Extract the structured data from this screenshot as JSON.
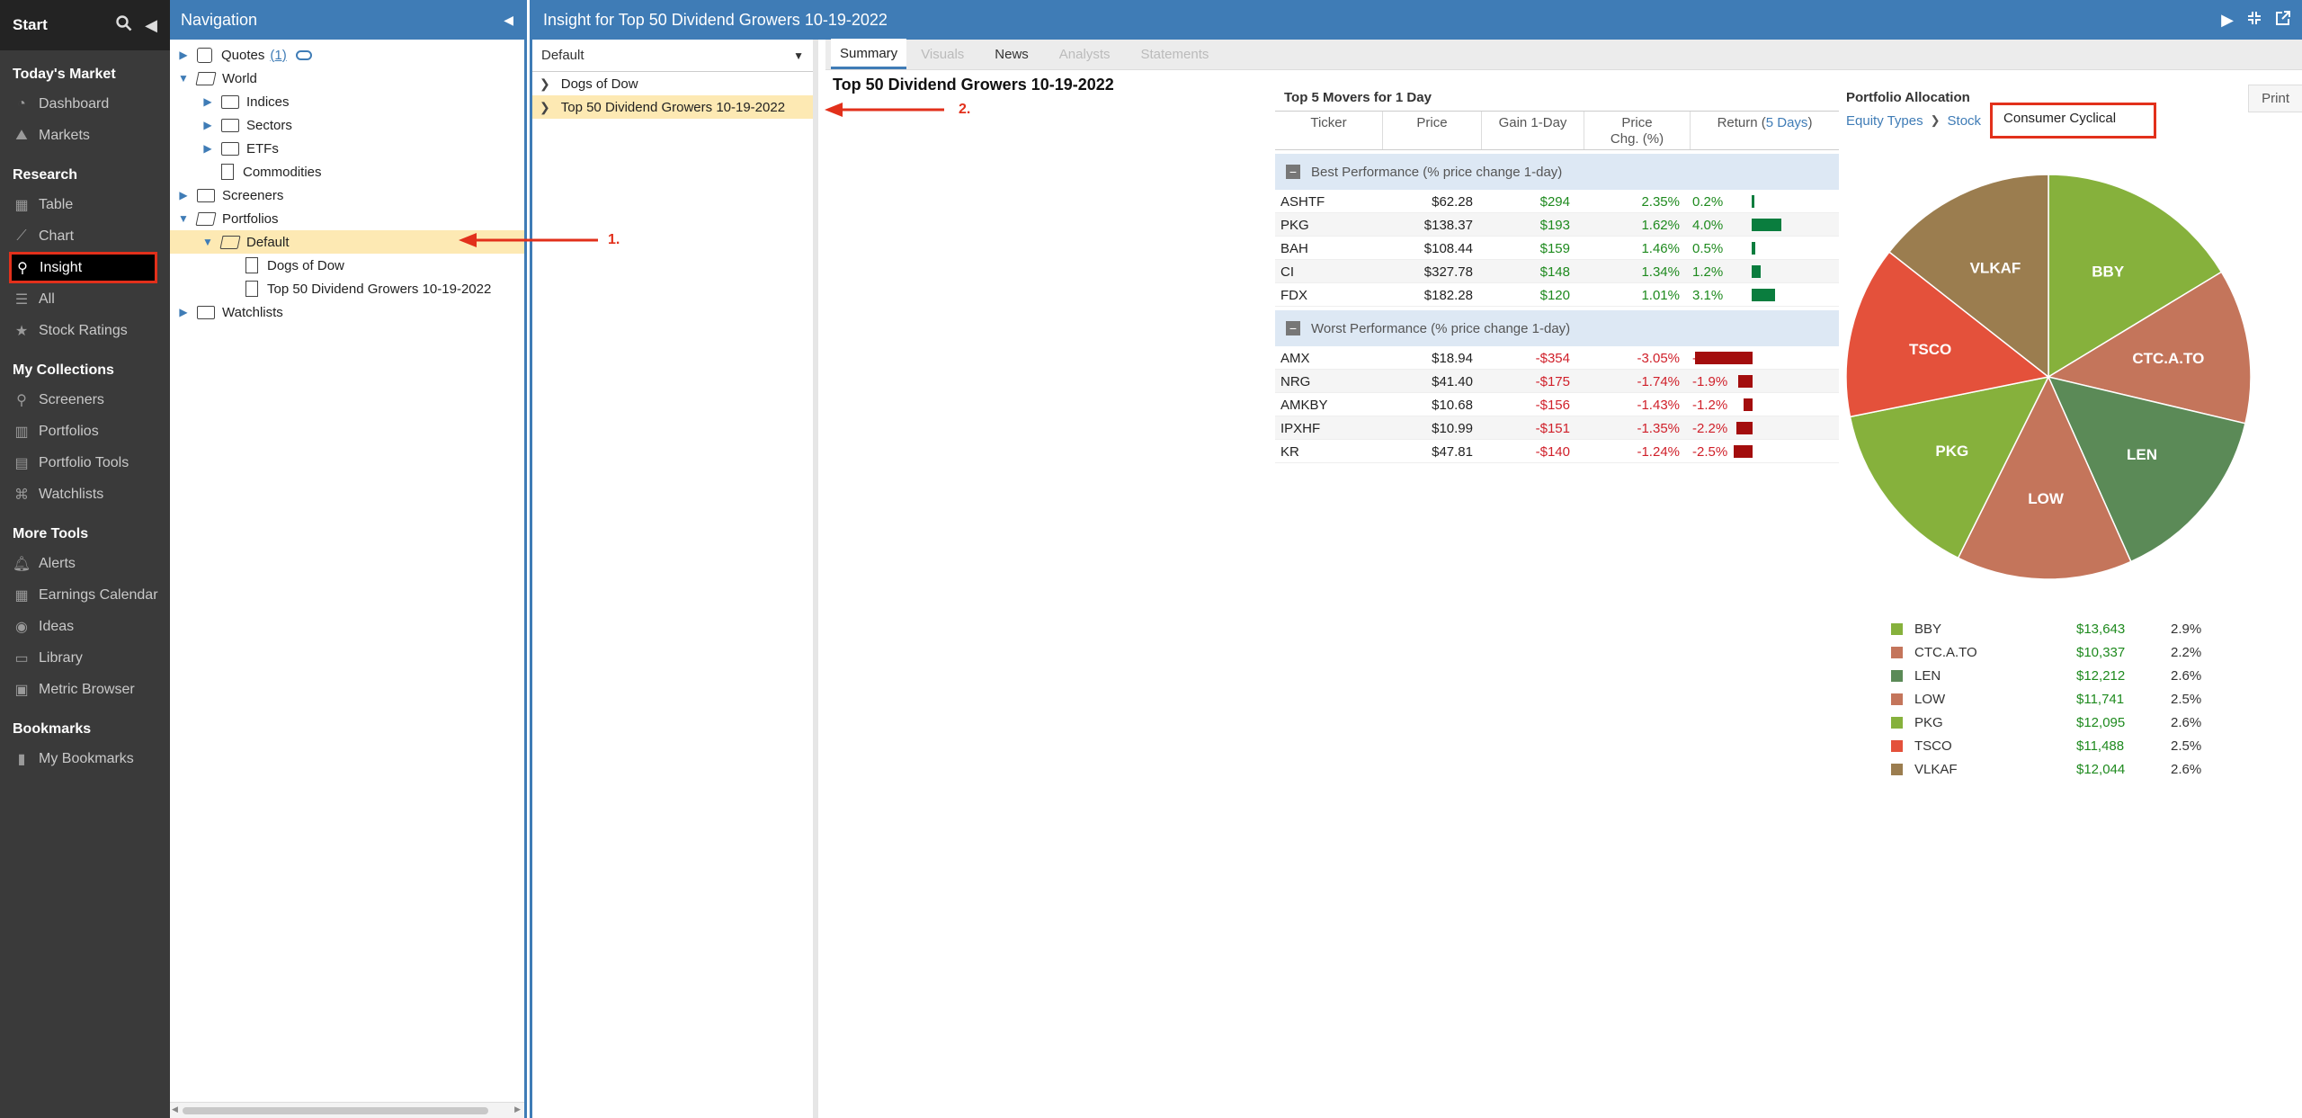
{
  "app": {
    "start_label": "Start"
  },
  "sidebar": {
    "sections": [
      {
        "title": "Today's Market",
        "items": [
          {
            "label": "Dashboard",
            "icon": "dashboard-icon"
          },
          {
            "label": "Markets",
            "icon": "area-chart-icon"
          }
        ]
      },
      {
        "title": "Research",
        "items": [
          {
            "label": "Table",
            "icon": "table-icon"
          },
          {
            "label": "Chart",
            "icon": "line-chart-icon"
          },
          {
            "label": "Insight",
            "icon": "microscope-icon",
            "active": true
          },
          {
            "label": "All",
            "icon": "list-icon"
          },
          {
            "label": "Stock Ratings",
            "icon": "star-icon"
          }
        ]
      },
      {
        "title": "My Collections",
        "items": [
          {
            "label": "Screeners",
            "icon": "search-icon"
          },
          {
            "label": "Portfolios",
            "icon": "briefcase-icon"
          },
          {
            "label": "Portfolio Tools",
            "icon": "chart-icon"
          },
          {
            "label": "Watchlists",
            "icon": "binoculars-icon"
          }
        ]
      },
      {
        "title": "More Tools",
        "items": [
          {
            "label": "Alerts",
            "icon": "bell-icon"
          },
          {
            "label": "Earnings Calendar",
            "icon": "calendar-icon"
          },
          {
            "label": "Ideas",
            "icon": "lightbulb-icon"
          },
          {
            "label": "Library",
            "icon": "book-icon"
          },
          {
            "label": "Metric Browser",
            "icon": "browser-icon"
          }
        ]
      },
      {
        "title": "Bookmarks",
        "items": [
          {
            "label": "My Bookmarks",
            "icon": "bookmark-icon"
          }
        ]
      }
    ]
  },
  "navigation": {
    "title": "Navigation",
    "tree": [
      {
        "label": "Quotes",
        "count": "(1)",
        "type": "quotes",
        "level": 0,
        "arrow": "right"
      },
      {
        "label": "World",
        "type": "folder-open",
        "level": 0,
        "arrow": "down"
      },
      {
        "label": "Indices",
        "type": "folder",
        "level": 1,
        "arrow": "right"
      },
      {
        "label": "Sectors",
        "type": "folder",
        "level": 1,
        "arrow": "right"
      },
      {
        "label": "ETFs",
        "type": "folder",
        "level": 1,
        "arrow": "right"
      },
      {
        "label": "Commodities",
        "type": "file",
        "level": 1,
        "arrow": ""
      },
      {
        "label": "Screeners",
        "type": "folder",
        "level": 0,
        "arrow": "right"
      },
      {
        "label": "Portfolios",
        "type": "folder-open",
        "level": 0,
        "arrow": "down"
      },
      {
        "label": "Default",
        "type": "folder-open",
        "level": 1,
        "arrow": "down",
        "selected": true
      },
      {
        "label": "Dogs of Dow",
        "type": "file",
        "level": 2,
        "arrow": ""
      },
      {
        "label": "Top 50 Dividend Growers 10-19-2022",
        "type": "file",
        "level": 2,
        "arrow": ""
      },
      {
        "label": "Watchlists",
        "type": "folder",
        "level": 0,
        "arrow": "right"
      }
    ]
  },
  "main": {
    "title": "Insight for Top 50 Dividend Growers 10-19-2022",
    "portfolio_select": "Default",
    "portfolios": [
      {
        "label": "Dogs of Dow",
        "selected": false
      },
      {
        "label": "Top 50 Dividend Growers 10-19-2022",
        "selected": true
      }
    ],
    "tabs": [
      {
        "label": "Summary",
        "state": "active"
      },
      {
        "label": "Visuals",
        "state": "disabled"
      },
      {
        "label": "News",
        "state": "enabled"
      },
      {
        "label": "Analysts",
        "state": "disabled"
      },
      {
        "label": "Statements",
        "state": "disabled"
      }
    ],
    "portfolio_title": "Top 50 Dividend Growers 10-19-2022"
  },
  "movers": {
    "title": "Top 5 Movers for 1 Day",
    "headers": {
      "ticker": "Ticker",
      "price": "Price",
      "gain": "Gain 1-Day",
      "chg1": "Price",
      "chg2": "Chg. (%)",
      "ret": "Return (",
      "ret_days": "5 Days",
      "ret_close": ")"
    },
    "best_label": "Best Performance (% price change 1-day)",
    "worst_label": "Worst Performance (% price change 1-day)",
    "best": [
      {
        "ticker": "ASHTF",
        "price": "$62.28",
        "gain": "$294",
        "chg": "2.35%",
        "ret": "0.2%",
        "ret_value": 0.2
      },
      {
        "ticker": "PKG",
        "price": "$138.37",
        "gain": "$193",
        "chg": "1.62%",
        "ret": "4.0%",
        "ret_value": 4.0
      },
      {
        "ticker": "BAH",
        "price": "$108.44",
        "gain": "$159",
        "chg": "1.46%",
        "ret": "0.5%",
        "ret_value": 0.5
      },
      {
        "ticker": "CI",
        "price": "$327.78",
        "gain": "$148",
        "chg": "1.34%",
        "ret": "1.2%",
        "ret_value": 1.2
      },
      {
        "ticker": "FDX",
        "price": "$182.28",
        "gain": "$120",
        "chg": "1.01%",
        "ret": "3.1%",
        "ret_value": 3.1
      }
    ],
    "worst": [
      {
        "ticker": "AMX",
        "price": "$18.94",
        "gain": "-$354",
        "chg": "-3.05%",
        "ret": "-7.7%",
        "ret_value": -7.7
      },
      {
        "ticker": "NRG",
        "price": "$41.40",
        "gain": "-$175",
        "chg": "-1.74%",
        "ret": "-1.9%",
        "ret_value": -1.9
      },
      {
        "ticker": "AMKBY",
        "price": "$10.68",
        "gain": "-$156",
        "chg": "-1.43%",
        "ret": "-1.2%",
        "ret_value": -1.2
      },
      {
        "ticker": "IPXHF",
        "price": "$10.99",
        "gain": "-$151",
        "chg": "-1.35%",
        "ret": "-2.2%",
        "ret_value": -2.2
      },
      {
        "ticker": "KR",
        "price": "$47.81",
        "gain": "-$140",
        "chg": "-1.24%",
        "ret": "-2.5%",
        "ret_value": -2.5
      }
    ],
    "colors": {
      "positive": "#0a7d3e",
      "negative": "#a30d0d"
    }
  },
  "allocation": {
    "title": "Portfolio Allocation",
    "print_label": "Print",
    "crumbs": [
      "Equity Types",
      "Stock"
    ],
    "current": "Consumer Cyclical"
  },
  "chart_data": {
    "type": "pie",
    "slices": [
      {
        "label": "BBY",
        "value": 13643,
        "value_label": "$13,643",
        "pct": "2.9%",
        "color": "#86b13c"
      },
      {
        "label": "CTC.A.TO",
        "value": 10337,
        "value_label": "$10,337",
        "pct": "2.2%",
        "color": "#c4755b"
      },
      {
        "label": "LEN",
        "value": 12212,
        "value_label": "$12,212",
        "pct": "2.6%",
        "color": "#5b8a57"
      },
      {
        "label": "LOW",
        "value": 11741,
        "value_label": "$11,741",
        "pct": "2.5%",
        "color": "#c4755b"
      },
      {
        "label": "PKG",
        "value": 12095,
        "value_label": "$12,095",
        "pct": "2.6%",
        "color": "#86b13c"
      },
      {
        "label": "TSCO",
        "value": 11488,
        "value_label": "$11,488",
        "pct": "2.5%",
        "color": "#e4513b"
      },
      {
        "label": "VLKAF",
        "value": 12044,
        "value_label": "$12,044",
        "pct": "2.6%",
        "color": "#9b7d4f"
      }
    ]
  },
  "annotations": [
    "1.",
    "2."
  ]
}
